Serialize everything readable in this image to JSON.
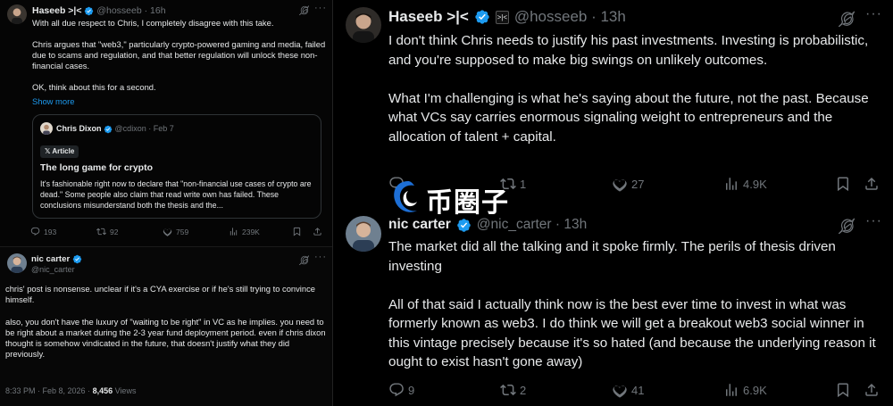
{
  "left_top": {
    "author_name": "Haseeb >|<",
    "handle_time": "@hosseeb · 16h",
    "body": "With all due respect to Chris, I completely disagree with this take.\n\nChris argues that \"web3,\" particularly crypto-powered gaming and media, failed due to scams and regulation, and that better regulation will unlock these non-financial cases.\n\nOK, think about this for a second.",
    "show_more": "Show more",
    "quote": {
      "author_name": "Chris Dixon",
      "handle_date": "@cdixon · Feb 7",
      "badge": "Article",
      "title": "The long game for crypto",
      "body": "It's fashionable right now to declare that \"non-financial use cases of crypto are dead.\" Some people also claim that read write own has failed. These conclusions misunderstand both the thesis and the..."
    },
    "actions": {
      "replies": "193",
      "reposts": "92",
      "likes": "759",
      "views": "239K"
    }
  },
  "left_bottom": {
    "author_name": "nic carter",
    "handle": "@nic_carter",
    "body": "chris' post is  nonsense. unclear if it's a CYA exercise or if he's still trying to convince himself.\n\nalso, you don't have the luxury of \"waiting to be right\" in VC as he implies. you need to be right about a market during the 2-3 year fund deployment period. even if chris dixon thought is somehow vindicated in the future, that doesn't justify what they did previously.",
    "meta_time": "8:33 PM · Feb 8, 2026 · ",
    "meta_views_count": "8,456",
    "meta_views_label": " Views"
  },
  "right_1": {
    "author_name": "Haseeb >|<",
    "handle_time": "@hosseeb · 13h",
    "body": "I don't think Chris needs to justify his past investments. Investing is probabilistic, and you're supposed to make big swings on unlikely outcomes.\n\nWhat I'm challenging is what he's saying about the future, not the past. Because what VCs say carries enormous signaling weight to entrepreneurs and the allocation of talent + capital.",
    "actions": {
      "replies": "",
      "reposts": "1",
      "likes": "27",
      "views": "4.9K"
    }
  },
  "right_2": {
    "author_name": "nic carter",
    "handle_time": "@nic_carter · 13h",
    "body": "The market did all the talking and it spoke firmly. The perils of thesis driven investing\n\nAll of that said I actually think now is the best ever time to invest in what was formerly known as web3. I do think we will get a breakout web3 social winner in this vintage precisely because it's so hated (and because the underlying reason it ought to exist hasn't gone away)",
    "actions": {
      "replies": "9",
      "reposts": "2",
      "likes": "41",
      "views": "6.9K"
    }
  },
  "watermark": {
    "text": "币圈子"
  },
  "colors": {
    "background": "#000000",
    "text": "#e7e9ea",
    "muted": "#71767b",
    "accent": "#1d9bf0"
  }
}
